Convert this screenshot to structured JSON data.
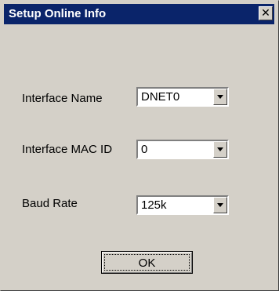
{
  "window": {
    "title": "Setup Online Info",
    "close_glyph": "✕",
    "colors": {
      "titlebar": "#0a246a",
      "face": "#d4d0c8"
    }
  },
  "fields": [
    {
      "label": "Interface Name",
      "value": "DNET0"
    },
    {
      "label": "Interface MAC ID",
      "value": "0"
    },
    {
      "label": "Baud Rate",
      "value": "125k"
    }
  ],
  "buttons": {
    "ok_label": "OK"
  },
  "icons": {
    "close": "close-icon",
    "dropdown": "chevron-down-icon"
  }
}
